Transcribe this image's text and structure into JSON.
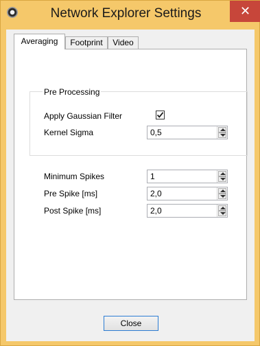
{
  "window": {
    "title": "Network Explorer Settings",
    "close_glyph": "✕",
    "app_icon": "network-explorer-icon"
  },
  "tabs": [
    {
      "label": "Averaging",
      "active": true
    },
    {
      "label": "Footprint",
      "active": false
    },
    {
      "label": "Video",
      "active": false
    }
  ],
  "pre_processing": {
    "legend": "Pre Processing",
    "gaussian_label": "Apply Gaussian Filter",
    "gaussian_checked": true,
    "kernel_label": "Kernel Sigma",
    "kernel_value": "0,5"
  },
  "spikes": {
    "min_label": "Minimum Spikes",
    "min_value": "1",
    "pre_label": "Pre Spike [ms]",
    "pre_value": "2,0",
    "post_label": "Post Spike [ms]",
    "post_value": "2,0"
  },
  "footer": {
    "close_label": "Close"
  },
  "colors": {
    "title_bar": "#f5c86a",
    "close_button": "#c7463a",
    "focus_border": "#2b7cd3"
  }
}
